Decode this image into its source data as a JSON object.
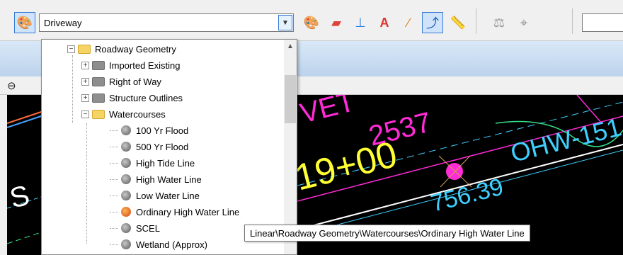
{
  "toolbar": {
    "feature_select_value": "Driveway"
  },
  "tree": {
    "items": [
      {
        "label": "Roadway Geometry",
        "depth": 0,
        "type": "folder",
        "color": "yellow",
        "expander": "−"
      },
      {
        "label": "Imported Existing",
        "depth": 1,
        "type": "folder",
        "color": "gray",
        "expander": "+"
      },
      {
        "label": "Right of Way",
        "depth": 1,
        "type": "folder",
        "color": "gray",
        "expander": "+"
      },
      {
        "label": "Structure Outlines",
        "depth": 1,
        "type": "folder",
        "color": "gray",
        "expander": "+"
      },
      {
        "label": "Watercourses",
        "depth": 1,
        "type": "folder",
        "color": "yellow",
        "expander": "−"
      },
      {
        "label": "100 Yr Flood",
        "depth": 2,
        "type": "leaf"
      },
      {
        "label": "500 Yr Flood",
        "depth": 2,
        "type": "leaf"
      },
      {
        "label": "High Tide Line",
        "depth": 2,
        "type": "leaf"
      },
      {
        "label": "High Water Line",
        "depth": 2,
        "type": "leaf"
      },
      {
        "label": "Low Water Line",
        "depth": 2,
        "type": "leaf"
      },
      {
        "label": "Ordinary High Water Line",
        "depth": 2,
        "type": "leaf",
        "highlighted": true
      },
      {
        "label": "SCEL",
        "depth": 2,
        "type": "leaf"
      },
      {
        "label": "Wetland (Approx)",
        "depth": 2,
        "type": "leaf"
      }
    ]
  },
  "tooltip": "Linear\\Roadway Geometry\\Watercourses\\Ordinary High Water Line",
  "canvas": {
    "labels": [
      "VET",
      "2537",
      "19+00",
      "756.39",
      "OHW-151",
      "S"
    ]
  },
  "colors": {
    "canvas_bg": "#000000",
    "magenta": "#ff2bd6",
    "yellow": "#ffff33",
    "cyan": "#3fd0ff",
    "accent": "#3a7bd5"
  }
}
